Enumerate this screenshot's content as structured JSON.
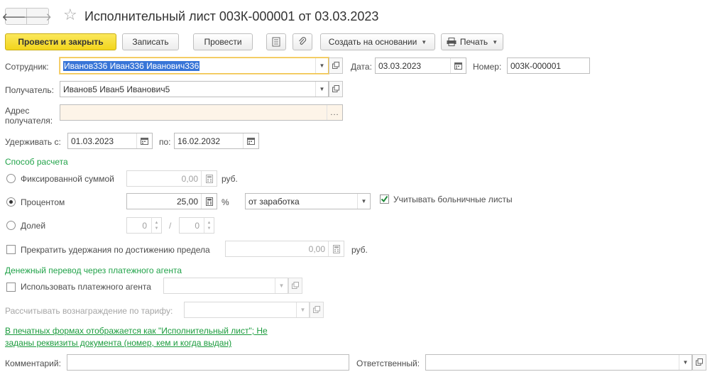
{
  "window": {
    "title": "Исполнительный лист 003К-000001 от 03.03.2023"
  },
  "toolbar": {
    "post_close": "Провести и закрыть",
    "save": "Записать",
    "post": "Провести",
    "create_based": "Создать на основании",
    "print": "Печать"
  },
  "form": {
    "employee": {
      "label": "Сотрудник:",
      "value": "Иванов336 Иван336 Иванович336"
    },
    "date": {
      "label": "Дата:",
      "value": "03.03.2023"
    },
    "number": {
      "label": "Номер:",
      "value": "003К-000001"
    },
    "recipient": {
      "label": "Получатель:",
      "value": "Иванов5 Иван5 Иванович5"
    },
    "address": {
      "label_line1": "Адрес",
      "label_line2": "получателя:",
      "value": ""
    },
    "withhold_from": {
      "label": "Удерживать с:",
      "value": "01.03.2023"
    },
    "withhold_to": {
      "label": "по:",
      "value": "16.02.2032"
    }
  },
  "calc": {
    "section_title": "Способ расчета",
    "fixed": {
      "label": "Фиксированной суммой",
      "value": "0,00",
      "unit": "руб.",
      "selected": false
    },
    "percent": {
      "label": "Процентом",
      "value": "25,00",
      "unit": "%",
      "base": "от заработка",
      "selected": true
    },
    "sick_leave": {
      "label": "Учитывать больничные листы",
      "checked": true
    },
    "share": {
      "label": "Долей",
      "numerator": "0",
      "separator": "/",
      "denominator": "0",
      "selected": false
    },
    "stop_limit": {
      "label": "Прекратить удержания по достижению предела",
      "value": "0,00",
      "unit": "руб.",
      "checked": false
    }
  },
  "agent": {
    "section_title": "Денежный перевод через платежного агента",
    "use_agent": {
      "label": "Использовать платежного агента",
      "checked": false,
      "value": ""
    },
    "tariff": {
      "label": "Рассчитывать вознаграждение по тарифу:",
      "value": ""
    }
  },
  "notice": {
    "line1": "В печатных формах отображается как \"Исполнительный лист\"; Не",
    "line2": "заданы реквизиты документа (номер, кем и когда выдан)"
  },
  "footer": {
    "comment": {
      "label": "Комментарий:",
      "value": ""
    },
    "responsible": {
      "label": "Ответственный:",
      "value": ""
    }
  }
}
